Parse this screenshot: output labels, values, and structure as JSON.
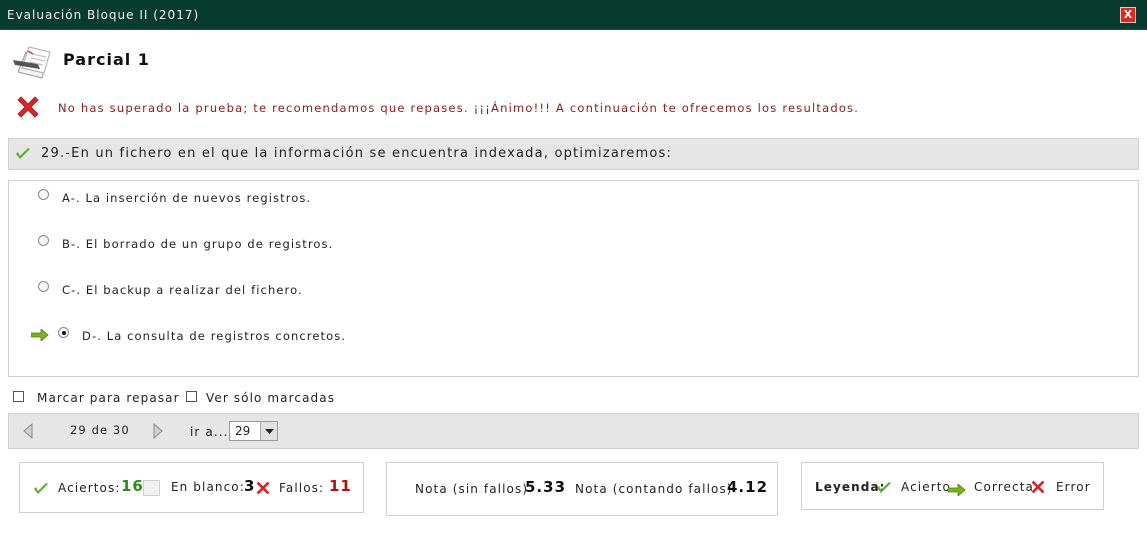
{
  "window": {
    "title": "Evaluación Bloque II (2017)",
    "close_label": "X"
  },
  "exam": {
    "title": "Parcial 1",
    "result_message": "No has superado la prueba; te recomendamos que repases. ¡¡¡Ánimo!!! A continuación te ofrecemos los resultados."
  },
  "question": {
    "text": "29.-En un fichero en el que la información se encuentra indexada, optimizaremos:",
    "options": [
      {
        "label": "A-. La inserción de nuevos registros."
      },
      {
        "label": "B-. El borrado de un grupo de registros."
      },
      {
        "label": "C-. El backup a realizar del fichero."
      },
      {
        "label": "D-. La consulta de registros concretos."
      }
    ]
  },
  "controls": {
    "mark_review": "Marcar para repasar",
    "show_marked": "Ver sólo marcadas"
  },
  "navigation": {
    "position": "29 de 30",
    "goto_label": "ir a...",
    "goto_value": "29"
  },
  "results": {
    "correct_label": "Aciertos:",
    "correct_value": "16",
    "blank_label": "En blanco:",
    "blank_value": "3",
    "wrong_label": "Fallos:",
    "wrong_value": "11",
    "score_no_penalty_label": "Nota (sin fallos)",
    "score_no_penalty_value": "5.33",
    "score_penalty_label": "Nota (contando fallos)",
    "score_penalty_value": "4.12"
  },
  "legend": {
    "title": "Leyenda:",
    "correct": "Acierto",
    "right_answer": "Correcta",
    "error": "Error"
  },
  "colors": {
    "titlebar": "#073c2f",
    "error_red": "#8b1a1a",
    "correct_green": "#2b8a1a",
    "wrong_red": "#b01010",
    "arrow_green": "#79b41e"
  }
}
